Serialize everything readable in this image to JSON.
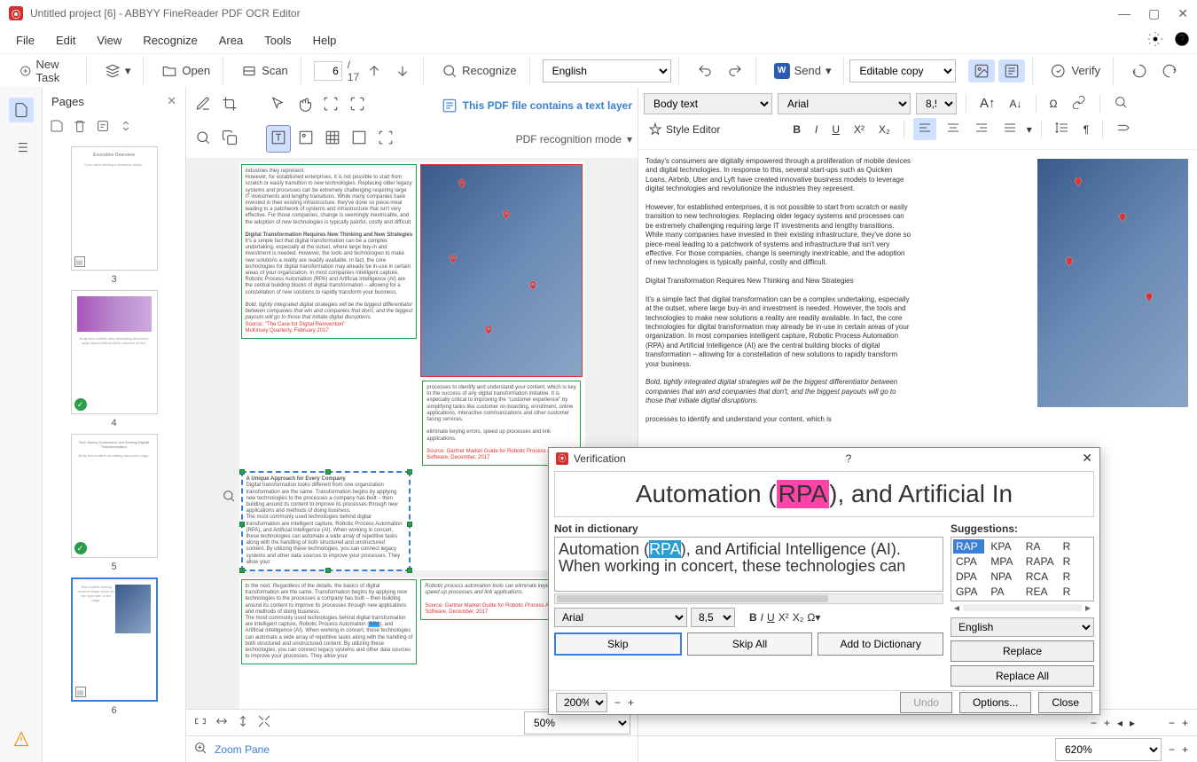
{
  "window": {
    "title": "Untitled project [6] - ABBYY FineReader PDF OCR Editor"
  },
  "menu": {
    "file": "File",
    "edit": "Edit",
    "view": "View",
    "recognize": "Recognize",
    "area": "Area",
    "tools": "Tools",
    "help": "Help"
  },
  "toolbar": {
    "newtask": "New Task",
    "open": "Open",
    "scan": "Scan",
    "page_current": "6",
    "page_total": "/ 17",
    "recognize": "Recognize",
    "lang": "English",
    "send": "Send",
    "editable": "Editable copy",
    "verify": "Verify"
  },
  "pages": {
    "title": "Pages",
    "thumbs": [
      {
        "n": "3",
        "title": "Executive Overview"
      },
      {
        "n": "4",
        "title": ""
      },
      {
        "n": "5",
        "title": "Tech Savvy Customers Are Driving Digital Transformation"
      },
      {
        "n": "6",
        "title": ""
      }
    ]
  },
  "imgpanel": {
    "info": "This PDF file contains a text layer",
    "recmode": "PDF recognition mode",
    "zoom": "50%",
    "zoompane": "Zoom Pane"
  },
  "textpanel": {
    "style": "Body text",
    "font": "Arial",
    "size": "8,5",
    "styleeditor": "Style Editor",
    "zoom": "620%"
  },
  "verify": {
    "title": "Verification",
    "snippet_pre": "Automation (",
    "snippet_hl": "RPA",
    "snippet_post": "), and Artificial In",
    "notindict": "Not in dictionary",
    "edit_pre": "Automation (",
    "edit_sel": "RPA",
    "edit_post": "), and Artificial Intelligence (AI). When working in concert, these technologies can",
    "font": "Arial",
    "size": "8,5",
    "skip": "Skip",
    "skipall": "Skip All",
    "addto": "Add to Dictionary",
    "suggestions_label": "Suggestions:",
    "suggestions": [
      "RAP",
      "KPA",
      "RA",
      "R",
      "CPA",
      "MPA",
      "RAPA",
      "R",
      "DPA",
      "NPA",
      "RCA",
      "R",
      "GPA",
      "PA",
      "REA",
      "R"
    ],
    "lang": "English",
    "replace": "Replace",
    "replaceall": "Replace All",
    "zoom": "200%",
    "undo": "Undo",
    "options": "Options...",
    "close": "Close"
  }
}
